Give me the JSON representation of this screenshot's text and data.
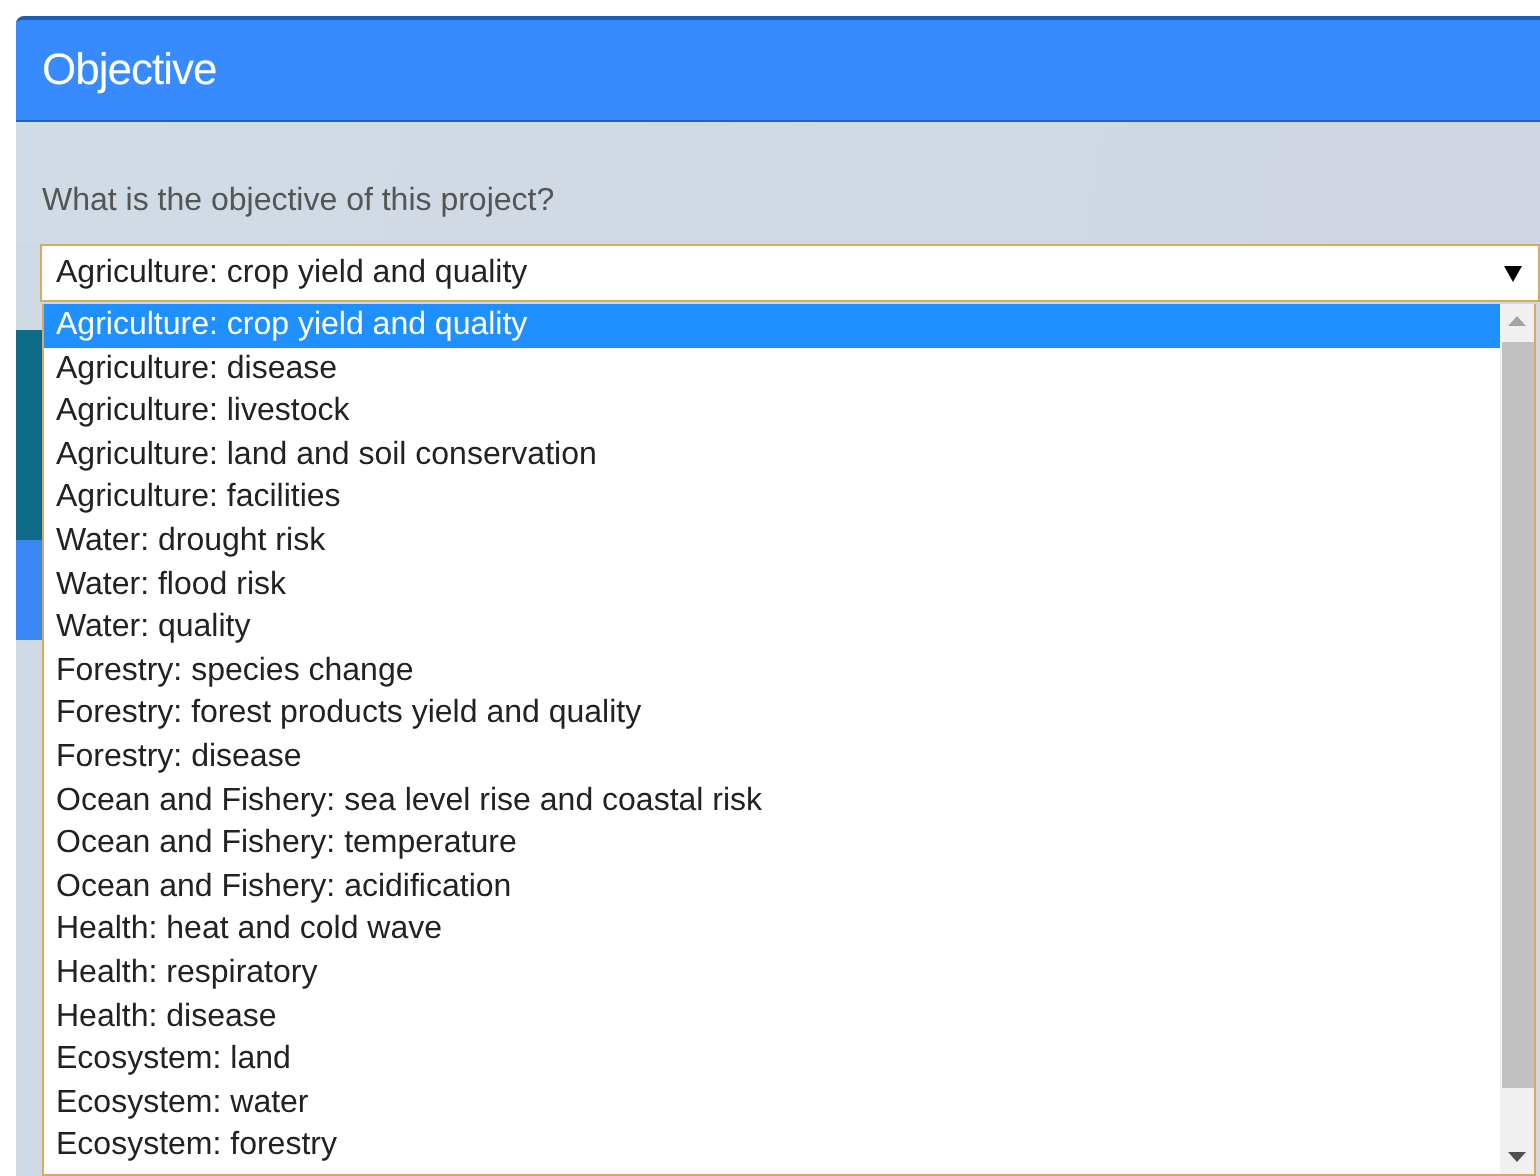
{
  "dialog": {
    "title": "Objective"
  },
  "question": {
    "label": "What is the objective of this project?"
  },
  "select": {
    "value": "Agriculture: crop yield and quality"
  },
  "options": [
    {
      "label": "Agriculture: crop yield and quality",
      "selected": true
    },
    {
      "label": "Agriculture: disease",
      "selected": false
    },
    {
      "label": "Agriculture: livestock",
      "selected": false
    },
    {
      "label": "Agriculture: land and soil conservation",
      "selected": false
    },
    {
      "label": "Agriculture: facilities",
      "selected": false
    },
    {
      "label": "Water: drought risk",
      "selected": false
    },
    {
      "label": "Water: flood risk",
      "selected": false
    },
    {
      "label": "Water: quality",
      "selected": false
    },
    {
      "label": "Forestry: species change",
      "selected": false
    },
    {
      "label": "Forestry: forest products yield and quality",
      "selected": false
    },
    {
      "label": "Forestry: disease",
      "selected": false
    },
    {
      "label": "Ocean and Fishery: sea level rise and coastal risk",
      "selected": false
    },
    {
      "label": "Ocean and Fishery: temperature",
      "selected": false
    },
    {
      "label": "Ocean and Fishery: acidification",
      "selected": false
    },
    {
      "label": "Health: heat and cold wave",
      "selected": false
    },
    {
      "label": "Health: respiratory",
      "selected": false
    },
    {
      "label": "Health: disease",
      "selected": false
    },
    {
      "label": "Ecosystem: land",
      "selected": false
    },
    {
      "label": "Ecosystem: water",
      "selected": false
    },
    {
      "label": "Ecosystem: forestry",
      "selected": false
    }
  ]
}
